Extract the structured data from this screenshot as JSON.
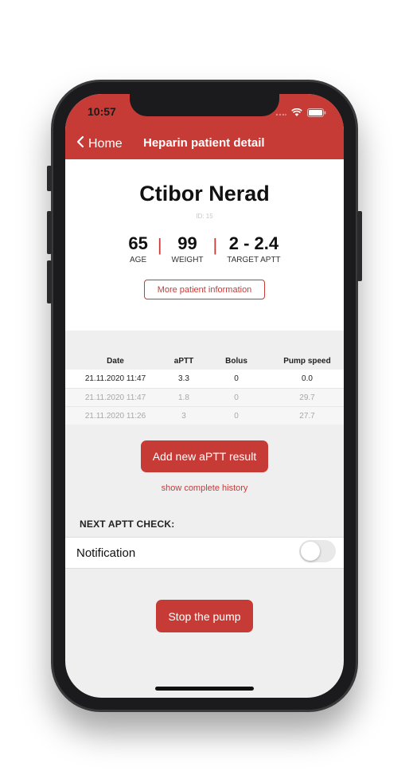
{
  "status_bar": {
    "time": "10:57"
  },
  "nav": {
    "back_label": "Home",
    "title": "Heparin patient detail"
  },
  "patient": {
    "name": "Ctibor Nerad",
    "id_text": "ID: 15",
    "stats": [
      {
        "value": "65",
        "label": "AGE"
      },
      {
        "value": "99",
        "label": "WEIGHT"
      },
      {
        "value": "2 - 2.4",
        "label": "TARGET APTT"
      }
    ],
    "more_button": "More patient information"
  },
  "table": {
    "headers": [
      "Date",
      "aPTT",
      "Bolus",
      "Pump speed"
    ],
    "rows": [
      [
        "21.11.2020 11:47",
        "3.3",
        "0",
        "0.0"
      ],
      [
        "21.11.2020 11:47",
        "1.8",
        "0",
        "29.7"
      ],
      [
        "21.11.2020 11:26",
        "3",
        "0",
        "27.7"
      ]
    ]
  },
  "actions": {
    "add_result": "Add new aPTT result",
    "show_history": "show complete history",
    "stop_pump": "Stop the pump"
  },
  "next_check": {
    "title": "NEXT APTT CHECK:",
    "notification_label": "Notification",
    "notification_enabled": false
  },
  "colors": {
    "accent": "#c73b37",
    "background": "#efeff0"
  }
}
